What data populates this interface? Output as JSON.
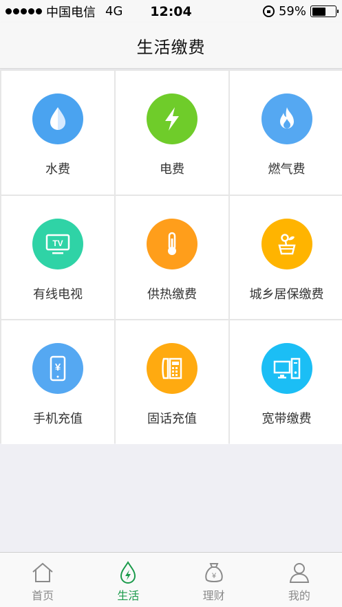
{
  "status_bar": {
    "carrier": "中国电信",
    "network": "4G",
    "time": "12:04",
    "battery": "59%",
    "battery_level": 0.59
  },
  "header": {
    "title": "生活缴费"
  },
  "services": [
    {
      "label": "水费",
      "icon": "water-drop-icon",
      "color": "#4aa3f0"
    },
    {
      "label": "电费",
      "icon": "lightning-icon",
      "color": "#6fcc2a"
    },
    {
      "label": "燃气费",
      "icon": "flame-icon",
      "color": "#55a8f2"
    },
    {
      "label": "有线电视",
      "icon": "tv-icon",
      "color": "#2fd3a6"
    },
    {
      "label": "供热缴费",
      "icon": "thermometer-icon",
      "color": "#ff9e1b"
    },
    {
      "label": "城乡居保缴费",
      "icon": "plant-icon",
      "color": "#ffb400"
    },
    {
      "label": "手机充值",
      "icon": "mobile-yuan-icon",
      "color": "#55a8f2"
    },
    {
      "label": "固话充值",
      "icon": "telephone-icon",
      "color": "#ffaa10"
    },
    {
      "label": "宽带缴费",
      "icon": "computer-icon",
      "color": "#1bbef5"
    }
  ],
  "tabs": [
    {
      "label": "首页",
      "icon": "home-icon",
      "active": false
    },
    {
      "label": "生活",
      "icon": "life-drop-icon",
      "active": true
    },
    {
      "label": "理财",
      "icon": "money-bag-icon",
      "active": false
    },
    {
      "label": "我的",
      "icon": "user-icon",
      "active": false
    }
  ],
  "colors": {
    "active_tab": "#1a9a4a",
    "inactive_tab": "#8a8a8a"
  }
}
